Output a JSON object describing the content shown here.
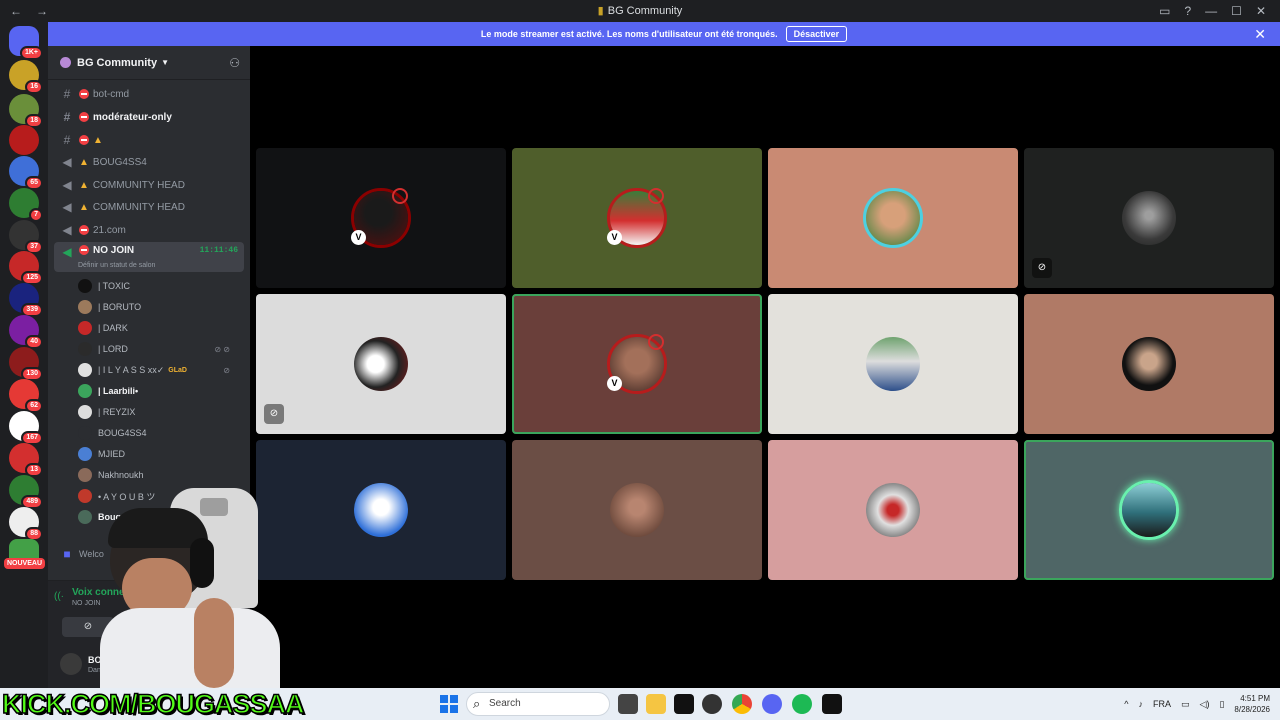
{
  "window": {
    "title": "BG Community"
  },
  "banner": {
    "message": "Le mode streamer est activé. Les noms d'utilisateur ont été tronqués.",
    "button": "Désactiver"
  },
  "rail": {
    "home_badge": "1K+",
    "badges": [
      "16",
      "18",
      "",
      "65",
      "7",
      "37",
      "125",
      "339",
      "40",
      "130",
      "62",
      "167",
      "13",
      "489",
      "88"
    ],
    "nouveau": "NOUVEAU"
  },
  "server": {
    "name": "BG Community"
  },
  "channels": [
    {
      "name": "bot-cmd",
      "type": "text"
    },
    {
      "name": "modérateur-only",
      "type": "text"
    },
    {
      "name": "",
      "type": "text"
    },
    {
      "name": "BOUG4SS4",
      "type": "voice"
    },
    {
      "name": "COMMUNITY HEAD",
      "type": "voice"
    },
    {
      "name": "COMMUNITY HEAD",
      "type": "voice"
    },
    {
      "name": "21.com",
      "type": "voice"
    },
    {
      "name": "NO JOIN",
      "type": "voice",
      "time": "11:11:46",
      "status": "Définir un statut de salon"
    }
  ],
  "voice_members": [
    "| TOXIC",
    "| BORUTO",
    "| DARK",
    "| LORD",
    "| I L Y A S S xx✓",
    "| Laarbili•",
    "| REYZIX",
    "BOUG4SS4",
    "MJIED",
    "Nakhnoukh",
    "• A Y O U B ツ",
    "Bougassaa"
  ],
  "glad_tag": "GLaD",
  "welcome_channel": "Welco",
  "voice_panel": {
    "status": "Voix connec",
    "channel": "NO JOIN",
    "user": "BOUG4S",
    "user_status": "Dans"
  },
  "overlay": {
    "kick_url": "KICK.COM/BOUGASSAA"
  },
  "taskbar": {
    "search": "Search",
    "lang": "FRA",
    "time": "4:51 PM",
    "date": "8/28/2026"
  },
  "colors": {
    "blurple": "#5865f2",
    "speaking": "#3ba55c",
    "kick_green": "#53fc18"
  }
}
